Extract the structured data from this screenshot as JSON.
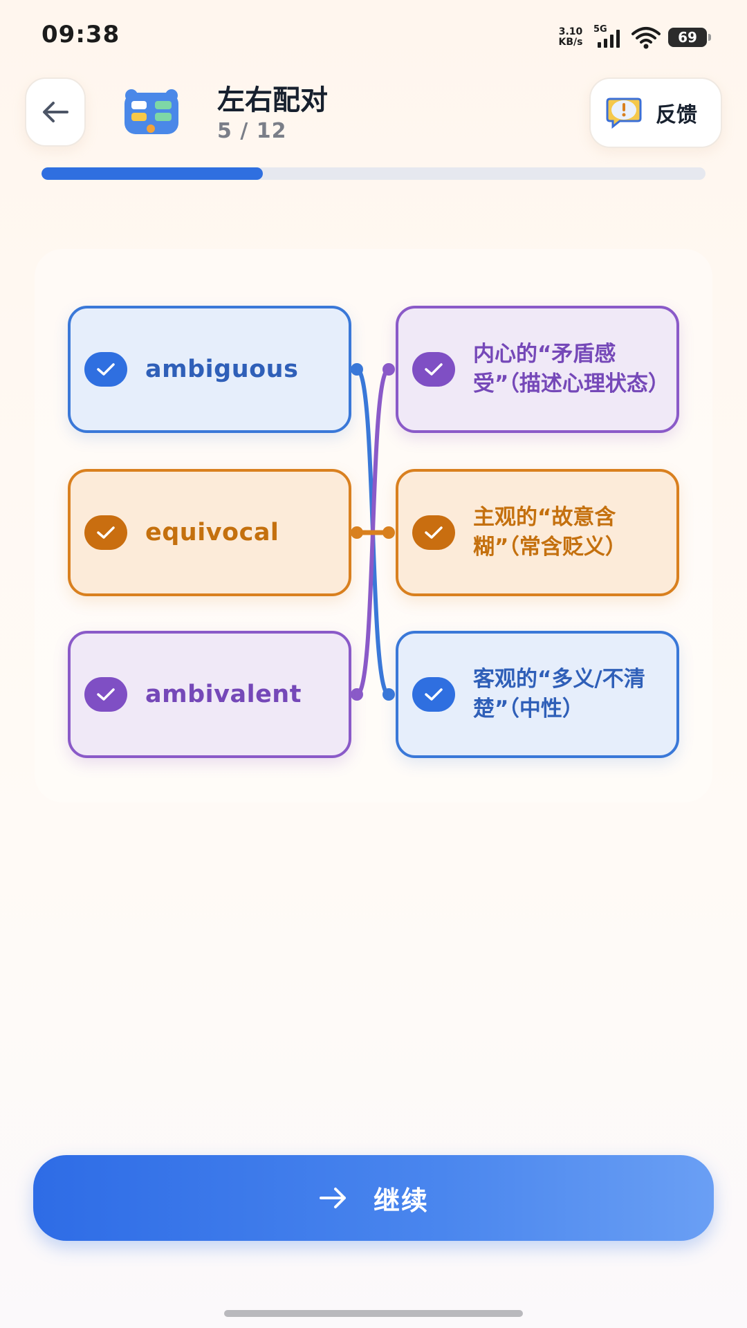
{
  "status_bar": {
    "time": "09:38",
    "net_speed_value": "3.10",
    "net_speed_unit": "KB/s",
    "network_type": "5G",
    "battery": "69"
  },
  "header": {
    "title": "左右配对",
    "progress_text": "5 / 12",
    "feedback_label": "反馈",
    "progress": 0.333
  },
  "left_items": [
    {
      "word": "ambiguous",
      "color": "blue"
    },
    {
      "word": "equivocal",
      "color": "orange"
    },
    {
      "word": "ambivalent",
      "color": "purple"
    }
  ],
  "right_items": [
    {
      "meaning": "内心的“矛盾感受”（描述心理状态）",
      "color": "purple"
    },
    {
      "meaning": "主观的“故意含糊”（常含贬义）",
      "color": "orange"
    },
    {
      "meaning": "客观的“多义/不清楚”（中性）",
      "color": "blue"
    }
  ],
  "colors": {
    "blue": "#3a78d8",
    "orange": "#d9801f",
    "purple": "#8a5ac8",
    "accent": "#2f6fe0"
  },
  "continue_label": "继续",
  "icons": {
    "back": "arrow-left-icon",
    "app": "matching-app-icon",
    "feedback": "feedback-alert-icon",
    "check": "checkmark-icon",
    "continue": "arrow-right-icon"
  }
}
